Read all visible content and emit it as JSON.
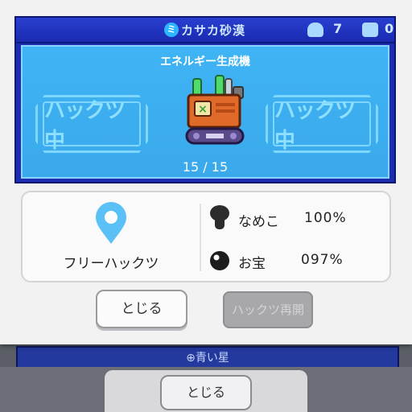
{
  "area": {
    "name": "カサカ砂漠"
  },
  "counters": [
    {
      "icon": "namekoid-icon",
      "value": "7"
    },
    {
      "icon": "treasure-pot-icon",
      "value": "0"
    }
  ],
  "machine": {
    "name": "エネルギー生成機",
    "progress": "15 / 15",
    "status_left": "ハックツ中",
    "status_right": "ハックツ中"
  },
  "info": {
    "route_label": "フリーハックツ",
    "stats": [
      {
        "icon": "nameko-icon",
        "label": "なめこ",
        "value": "100%"
      },
      {
        "icon": "treasure-orb-icon",
        "label": "お宝",
        "value": "097%"
      }
    ]
  },
  "buttons": {
    "close": "とじる",
    "resume": "ハックツ再開"
  },
  "background": {
    "planet_label": "青い星",
    "close": "とじる"
  },
  "colors": {
    "panel_blue": "#1d2db0",
    "screen_cyan": "#3fb4f4",
    "accent_pin": "#5bc0f5"
  }
}
